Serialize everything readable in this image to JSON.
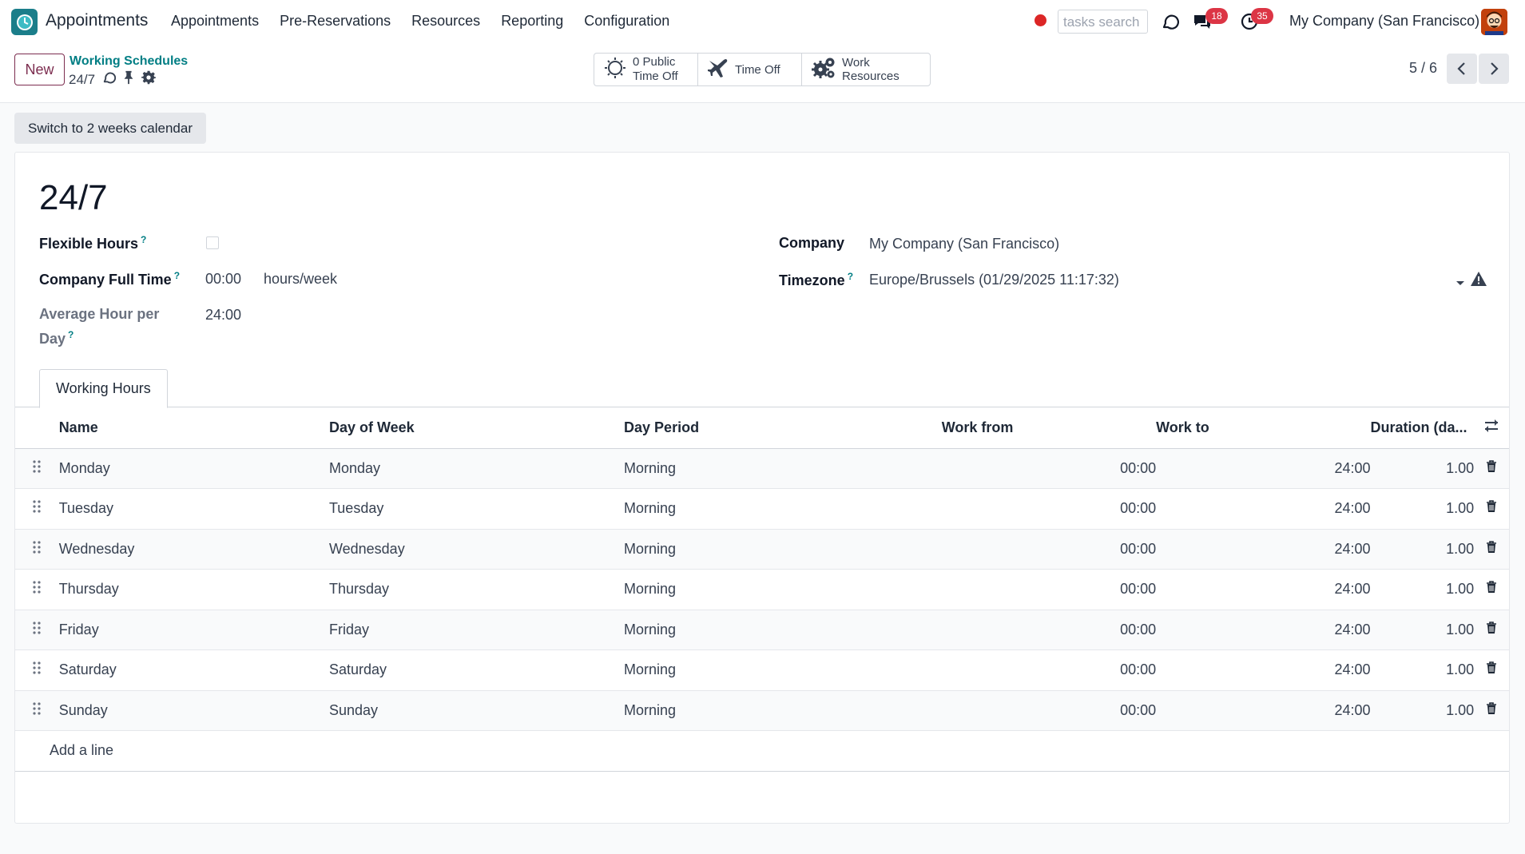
{
  "navbar": {
    "app_name": "Appointments",
    "menu": [
      "Appointments",
      "Pre-Reservations",
      "Resources",
      "Reporting",
      "Configuration"
    ],
    "search_placeholder": "tasks search",
    "messages_badge": "18",
    "activities_badge": "35",
    "company": "My Company (San Francisco)"
  },
  "control_panel": {
    "new_label": "New",
    "breadcrumb_parent": "Working Schedules",
    "breadcrumb_current": "24/7",
    "smart_buttons": {
      "public_time_off_line1": "0 Public",
      "public_time_off_line2": "Time Off",
      "time_off": "Time Off",
      "work_resources": "Work Resources"
    },
    "pager": "5 / 6"
  },
  "status_bar": {
    "switch_label": "Switch to 2 weeks calendar"
  },
  "form": {
    "title": "24/7",
    "flexible_hours_label": "Flexible Hours",
    "company_full_time_label": "Company Full Time",
    "company_full_time_value": "00:00",
    "company_full_time_unit": "hours/week",
    "avg_hour_label_line1": "Average Hour per",
    "avg_hour_label_line2": "Day",
    "avg_hour_value": "24:00",
    "company_label": "Company",
    "company_value": "My Company (San Francisco)",
    "timezone_label": "Timezone",
    "timezone_value": "Europe/Brussels (01/29/2025 11:17:32)",
    "help_mark": "?"
  },
  "tabs": {
    "working_hours": "Working Hours"
  },
  "lines_table": {
    "headers": {
      "name": "Name",
      "day_of_week": "Day of Week",
      "day_period": "Day Period",
      "work_from": "Work from",
      "work_to": "Work to",
      "duration": "Duration (da..."
    },
    "rows": [
      {
        "name": "Monday",
        "day": "Monday",
        "period": "Morning",
        "from": "00:00",
        "to": "24:00",
        "duration": "1.00"
      },
      {
        "name": "Tuesday",
        "day": "Tuesday",
        "period": "Morning",
        "from": "00:00",
        "to": "24:00",
        "duration": "1.00"
      },
      {
        "name": "Wednesday",
        "day": "Wednesday",
        "period": "Morning",
        "from": "00:00",
        "to": "24:00",
        "duration": "1.00"
      },
      {
        "name": "Thursday",
        "day": "Thursday",
        "period": "Morning",
        "from": "00:00",
        "to": "24:00",
        "duration": "1.00"
      },
      {
        "name": "Friday",
        "day": "Friday",
        "period": "Morning",
        "from": "00:00",
        "to": "24:00",
        "duration": "1.00"
      },
      {
        "name": "Saturday",
        "day": "Saturday",
        "period": "Morning",
        "from": "00:00",
        "to": "24:00",
        "duration": "1.00"
      },
      {
        "name": "Sunday",
        "day": "Sunday",
        "period": "Morning",
        "from": "00:00",
        "to": "24:00",
        "duration": "1.00"
      }
    ],
    "add_line": "Add a line"
  },
  "colors": {
    "brand_primary": "#7c2d4f",
    "link_teal": "#017e84",
    "badge_red": "#dc3545",
    "recording_red": "#dc2626"
  },
  "icons": [
    "appointments-app-icon",
    "refresh-icon",
    "chat-icon",
    "clock-icon",
    "avatar",
    "sync-icon",
    "pin-icon",
    "gear-icon",
    "sun-icon",
    "plane-icon",
    "gears-icon",
    "chevron-left-icon",
    "chevron-right-icon",
    "caret-down-icon",
    "warning-icon",
    "drag-handle-icon",
    "trash-icon",
    "column-settings-icon"
  ]
}
